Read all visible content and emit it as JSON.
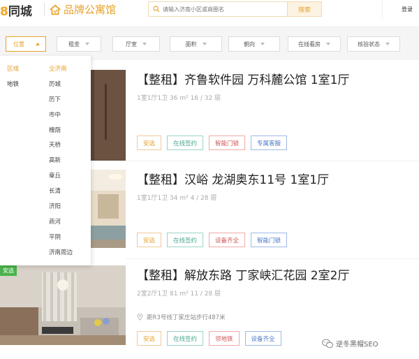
{
  "header": {
    "logo_brand_char": "8",
    "logo_text": "同城",
    "brand_text": "品牌公寓馆",
    "search_placeholder": "请输入济南小区或商圈名",
    "search_button": "搜索",
    "login_label": "登录"
  },
  "filters": [
    {
      "label": "位置",
      "active": true
    },
    {
      "label": "租金"
    },
    {
      "label": "厅室"
    },
    {
      "label": "面积"
    },
    {
      "label": "朝向"
    },
    {
      "label": "在线看房"
    },
    {
      "label": "核验状态"
    }
  ],
  "location_dropdown": {
    "col1": [
      {
        "label": "区域",
        "selected": true
      },
      {
        "label": "地铁"
      }
    ],
    "col2": [
      {
        "label": "全济南",
        "selected": true
      },
      {
        "label": "历城"
      },
      {
        "label": "历下"
      },
      {
        "label": "市中"
      },
      {
        "label": "槐荫"
      },
      {
        "label": "天桥"
      },
      {
        "label": "高新"
      },
      {
        "label": "章丘"
      },
      {
        "label": "长清"
      },
      {
        "label": "济阳"
      },
      {
        "label": "商河"
      },
      {
        "label": "平阴"
      },
      {
        "label": "济南周边"
      }
    ]
  },
  "listings": [
    {
      "title": "【整租】齐鲁软件园 万科麓公馆 1室1厅",
      "meta": "1室1厅1卫   36 m²   16 / 32 层",
      "tags": [
        "安选",
        "在线签约",
        "智能门锁",
        "专属客服"
      ]
    },
    {
      "title": "【整租】汉峪 龙湖奥东11号 1室1厅",
      "meta": "1室1厅1卫   34 m²   4 / 28 层",
      "tags": [
        "安选",
        "在线签约",
        "设备齐全",
        "智能门锁"
      ]
    },
    {
      "title": "【整租】解放东路 丁家峡汇花园 2室2厅",
      "meta": "2室2厅1卫   81 m²   11 / 28 层",
      "subway": "距R3号线丁家庄站步行487米",
      "badge": "安选",
      "tags": [
        "安选",
        "在线签约",
        "邻地铁",
        "设备齐全"
      ]
    }
  ],
  "watermark": "逆冬黑帽SEO"
}
